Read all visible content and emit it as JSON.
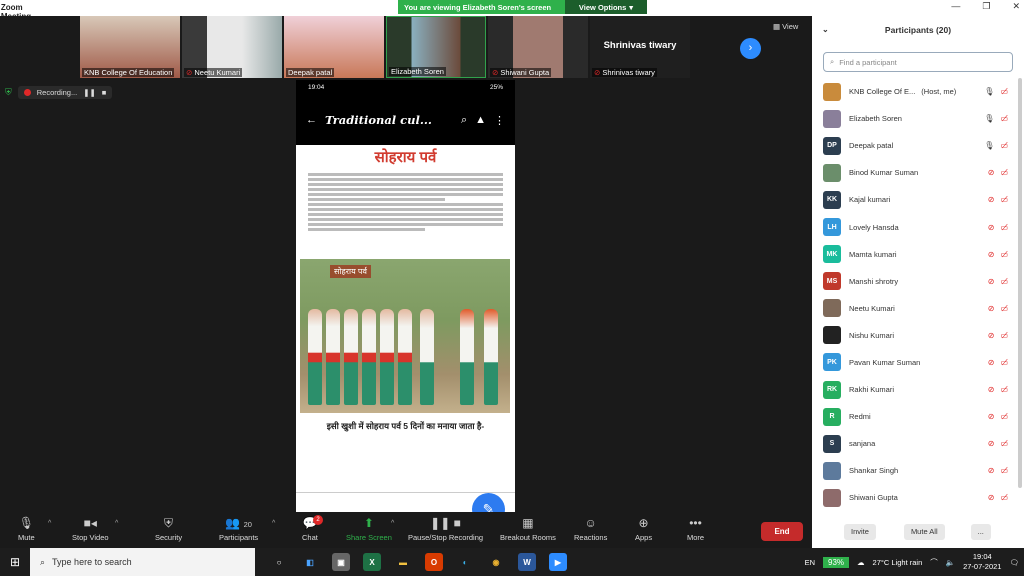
{
  "window": {
    "title": "Zoom Meeting"
  },
  "banner": {
    "text": "You are viewing Elizabeth Soren's screen",
    "options_label": "View Options"
  },
  "video_strip": {
    "tiles": [
      {
        "name": "KNB College Of Education",
        "muted": false
      },
      {
        "name": "Neetu Kumari",
        "muted": true
      },
      {
        "name": "Deepak patal",
        "muted": false
      },
      {
        "name": "Elizabeth Soren",
        "muted": false
      },
      {
        "name": "Shiwani Gupta",
        "muted": true
      },
      {
        "name": "Shrinivas tiwary",
        "muted": true,
        "big_name": "Shrinivas tiwary"
      }
    ],
    "view_label": "View"
  },
  "recording": {
    "label": "Recording..."
  },
  "shared_screen": {
    "status_time": "19:04",
    "status_battery": "25%",
    "app_title": "Traditional cul...",
    "doc_heading": "सोहराय पर्व",
    "photo_caption": "सोहराय पर्व",
    "doc_caption": "इसी खुशी में सोहराय पर्व 5 दिनों का मनाया जाता है-"
  },
  "toolbar": {
    "mute": "Mute",
    "stop_video": "Stop Video",
    "security": "Security",
    "participants": "Participants",
    "participants_count": "20",
    "chat": "Chat",
    "chat_badge": "2",
    "share_screen": "Share Screen",
    "pause_recording": "Pause/Stop Recording",
    "breakout": "Breakout Rooms",
    "reactions": "Reactions",
    "apps": "Apps",
    "more": "More",
    "end": "End"
  },
  "participants_panel": {
    "title": "Participants (20)",
    "search_placeholder": "Find a participant",
    "invite": "Invite",
    "mute_all": "Mute All",
    "more": "...",
    "people": [
      {
        "name": "KNB College Of E...",
        "tag": "(Host, me)",
        "initials": "",
        "color": "#c98b3c",
        "mic_muted": false,
        "video_off": true
      },
      {
        "name": "Elizabeth Soren",
        "tag": "",
        "initials": "",
        "color": "#8a7f9a",
        "mic_muted": false,
        "video_off": true
      },
      {
        "name": "Deepak patal",
        "tag": "",
        "initials": "DP",
        "color": "#2c3e50",
        "mic_muted": false,
        "video_off": true
      },
      {
        "name": "Binod Kumar Suman",
        "tag": "",
        "initials": "",
        "color": "#6b8e6b",
        "mic_muted": true,
        "video_off": true
      },
      {
        "name": "Kajal kumari",
        "tag": "",
        "initials": "KK",
        "color": "#2c3e50",
        "mic_muted": true,
        "video_off": true
      },
      {
        "name": "Lovely Hansda",
        "tag": "",
        "initials": "LH",
        "color": "#3498db",
        "mic_muted": true,
        "video_off": true
      },
      {
        "name": "Mamta kumari",
        "tag": "",
        "initials": "MK",
        "color": "#1abc9c",
        "mic_muted": true,
        "video_off": true
      },
      {
        "name": "Manshi shrotry",
        "tag": "",
        "initials": "MS",
        "color": "#c0392b",
        "mic_muted": true,
        "video_off": true
      },
      {
        "name": "Neetu Kumari",
        "tag": "",
        "initials": "",
        "color": "#7f6a5a",
        "mic_muted": true,
        "video_off": true
      },
      {
        "name": "Nishu Kumari",
        "tag": "",
        "initials": "",
        "color": "#222222",
        "mic_muted": true,
        "video_off": true
      },
      {
        "name": "Pavan Kumar Suman",
        "tag": "",
        "initials": "PK",
        "color": "#3498db",
        "mic_muted": true,
        "video_off": true
      },
      {
        "name": "Rakhi Kumari",
        "tag": "",
        "initials": "RK",
        "color": "#27ae60",
        "mic_muted": true,
        "video_off": true
      },
      {
        "name": "Redmi",
        "tag": "",
        "initials": "R",
        "color": "#27ae60",
        "mic_muted": true,
        "video_off": true
      },
      {
        "name": "sanjana",
        "tag": "",
        "initials": "S",
        "color": "#2c3e50",
        "mic_muted": true,
        "video_off": true
      },
      {
        "name": "Shankar Singh",
        "tag": "",
        "initials": "",
        "color": "#5d7a9c",
        "mic_muted": true,
        "video_off": true
      },
      {
        "name": "Shiwani Gupta",
        "tag": "",
        "initials": "",
        "color": "#8e6b6b",
        "mic_muted": true,
        "video_off": true
      }
    ]
  },
  "taskbar": {
    "search_placeholder": "Type here to search",
    "lang": "EN",
    "battery": "93%",
    "weather": "27°C  Light rain",
    "time": "19:04",
    "date": "27-07-2021"
  }
}
